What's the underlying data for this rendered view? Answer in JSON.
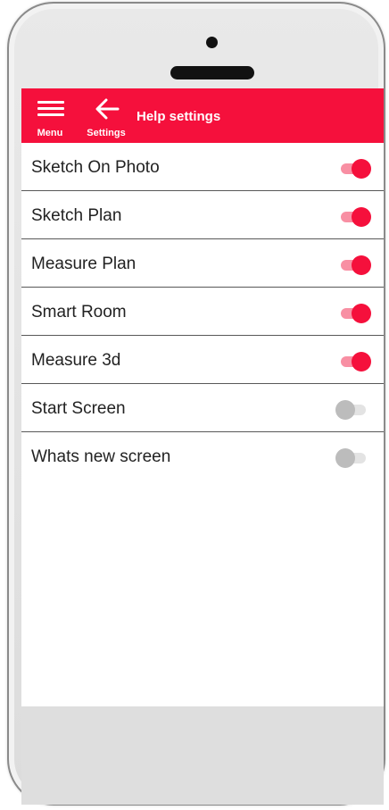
{
  "appbar": {
    "menu_label": "Menu",
    "back_label": "Settings",
    "title": "Help settings",
    "color": "#f5103c"
  },
  "settings": [
    {
      "label": "Sketch On Photo",
      "enabled": true
    },
    {
      "label": "Sketch Plan",
      "enabled": true
    },
    {
      "label": "Measure Plan",
      "enabled": true
    },
    {
      "label": "Smart Room",
      "enabled": true
    },
    {
      "label": "Measure 3d",
      "enabled": true
    },
    {
      "label": "Start Screen",
      "enabled": false
    },
    {
      "label": "Whats new screen",
      "enabled": false
    }
  ],
  "icons": {
    "menu": "hamburger-menu-icon",
    "back": "back-arrow-icon"
  }
}
